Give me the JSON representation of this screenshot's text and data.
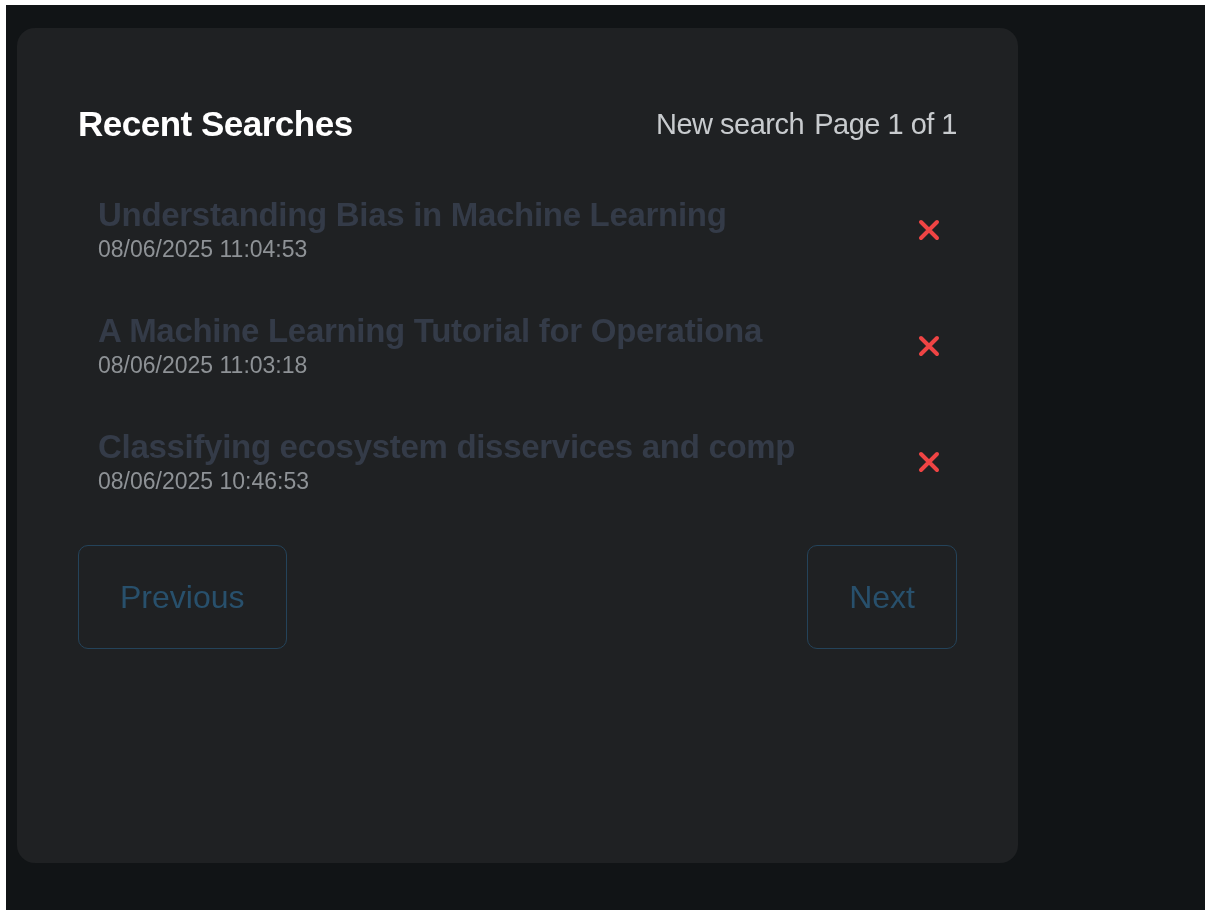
{
  "panel": {
    "title": "Recent Searches",
    "new_search": "New search",
    "page_info": "Page 1 of 1"
  },
  "searches": [
    {
      "title": "Understanding Bias in Machine Learning",
      "date": "08/06/2025 11:04:53"
    },
    {
      "title": "A Machine Learning Tutorial for Operationa",
      "date": "08/06/2025 11:03:18"
    },
    {
      "title": "Classifying ecosystem disservices and comp",
      "date": "08/06/2025 10:46:53"
    }
  ],
  "pagination": [
    {
      "label": "Previous",
      "disabled": true
    },
    {
      "label": "Next",
      "disabled": true
    }
  ]
}
